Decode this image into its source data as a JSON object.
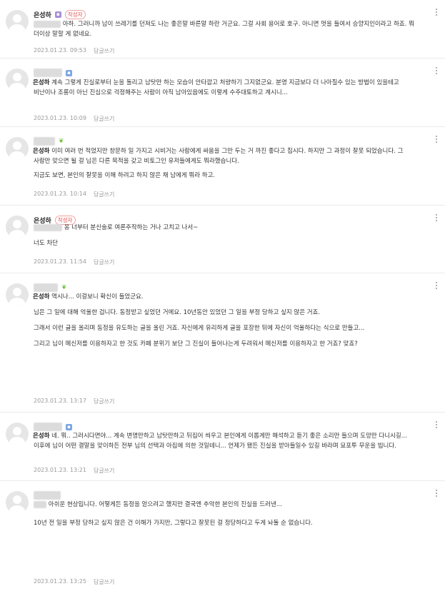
{
  "comments": [
    {
      "author": "은성하",
      "writer_badge": "작성자",
      "lines": [
        "아하. 그러니까 남이 쓰레기를 던져도 나는 좋은말 바른말 하란 거군요. 그걸 사회 용어로 호구. 아니면 멋을 들여서 승양지인이라고 하죠. 뭐 더이상 말할 게 없네요."
      ],
      "date": "2023.01.23. 09:53",
      "reply": "답글쓰기"
    },
    {
      "author": "은성하",
      "lines": [
        "계속 그렇게 진실로부터 눈을 돌리고 남탓만 하는 모습이 안타깝고 처량하기 그지없군요. 분명 지금보다 더 나아질수 있는 방법이 있을테고 비난이나 조롱이 아닌 진심으로 걱정해주는 사람이 아직 남아있음에도 이렇게 수주대토하고 계시니..."
      ],
      "date": "2023.01.23. 10:09",
      "reply": "답글쓰기"
    },
    {
      "author": "은성하",
      "lines": [
        "이미 여러 번 적었지만 창문하 일 가지고 시비거는 사람에게 싸움을 그만 두는 거 까진 좋다고 칩시다. 하지만 그 과정이 잘못 되었습니다. 그 사람만 맞으면 될 걸 님은 다른 목적을 갖고 비토그인 유저들에게도 뭐라했습니다.",
        "지금도 보면, 본인의 잘못을 이해 하려고 하지 않은 채 남에게 뭐라 하고."
      ],
      "date": "2023.01.23. 10:14",
      "reply": "답글쓰기"
    },
    {
      "author": "은성하",
      "writer_badge": "작성자",
      "lines": [
        "옹 너부터 분신술로 여론주작하는 거나 고치고 나서~",
        "너도 차단"
      ],
      "date": "2023.01.23. 11:54",
      "reply": "답글쓰기"
    },
    {
      "author": "은성하",
      "lines": [
        "역시나... 이걸보니 확신이 들었군요.",
        "님은 그 일에 대해 억울한 겁니다. 동정받고 싶었던 거에요. 10년동안 있었던 그 일을 부정 당하고 싶지 않은 거죠.",
        "그래서 이런 글을 올리며 동정을 유도하는 글을 올린 거죠. 자신에게 유리하게 글을 포장한 뒤에 자신이 억울하다는 식으로 만들고...",
        "그리고 님이 메신저를 이용하자고 한 것도 카페 분위기 보단 그 진실이 들어나는게 두려워서 메신저를 이용하자고 한 거죠? 맞죠?"
      ],
      "date": "2023.01.23. 13:17",
      "reply": "답글쓰기"
    },
    {
      "author": "은성하",
      "lines": [
        "네. 뭐.. 그러시다면야... 계속 변명만하고 남탓만하고 뒤집어 씌우고 본인에게 이롭게만 해석하고 듣기 좋은 소리만 들으며 도망만 다니시길... 이후에 님이 어떤 결말을 맞이하든 전부 님의 선택과 아집에 의한 것일테니... 언제가 됐든 진실을 받아들일수 있길 바라며 묘포투 무운을 빕니다."
      ],
      "date": "2023.01.23. 13:21",
      "reply": "답글쓰기"
    },
    {
      "lines": [
        "아쉬운 현상입니다. 어떻게든 동정을 얻으려고 했지만 결국엔 추악한 본인의 진실을 드러낸...",
        "10년 전 일을 부정 당하고 싶지 않은 건 이해가 가지만, 그렇다고 잘못된 걸 정당하다고 두게 놔둘 순 없습니다."
      ],
      "date": "2023.01.23. 13:25",
      "reply": "답글쓰기"
    }
  ]
}
